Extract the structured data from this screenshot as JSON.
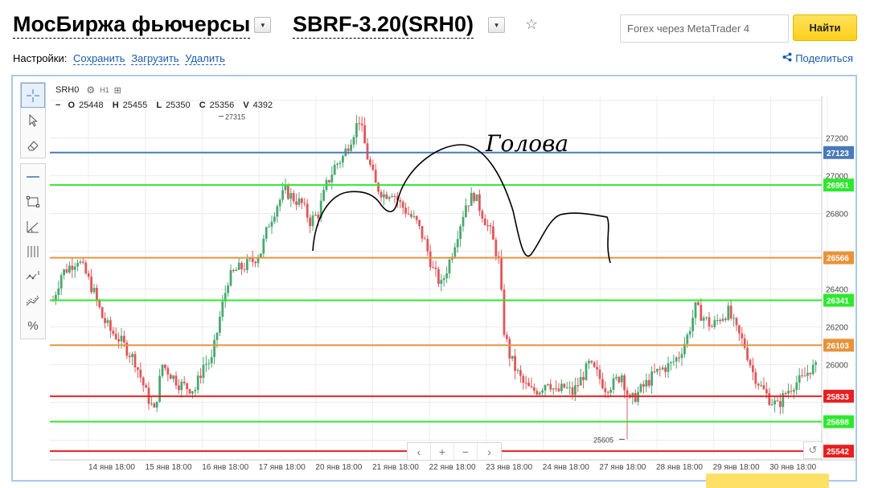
{
  "header": {
    "market_title": "МосБиржа фьючерсы",
    "symbol_title": "SBRF-3.20(SRH0)",
    "search_placeholder": "Forex через MetaTrader 4",
    "search_button": "Найти"
  },
  "settings": {
    "label": "Настройки:",
    "save": "Сохранить",
    "load": "Загрузить",
    "delete": "Удалить",
    "share": "Поделиться"
  },
  "legend": {
    "symbol": "SRH0",
    "timeframe": "H1",
    "o_label": "O",
    "o": "25448",
    "h_label": "H",
    "h": "25455",
    "l_label": "L",
    "l": "25350",
    "c_label": "C",
    "c": "25356",
    "v_label": "V",
    "v": "4392"
  },
  "colors": {
    "up": "#4aa870",
    "down": "#e0575b",
    "blue_level": "#4a7ab8",
    "green_level": "#2ee82e",
    "orange_level": "#e8933a",
    "red_level": "#e62020"
  },
  "icons": [
    "crosshair-icon",
    "cursor-icon",
    "eraser-icon",
    "horizontal-line-icon",
    "rectangle-icon",
    "trend-angle-icon",
    "vertical-lines-icon",
    "indicator-icon",
    "channel-icon",
    "percent-icon",
    "gear-icon",
    "compare-icon",
    "star-icon",
    "share-icon",
    "undo-icon"
  ],
  "chart_data": {
    "type": "candlestick",
    "symbol": "SRH0",
    "timeframe": "H1",
    "x_ticks": [
      "14 янв 18:00",
      "15 янв 18:00",
      "16 янв 18:00",
      "17 янв 18:00",
      "20 янв 18:00",
      "21 янв 18:00",
      "22 янв 18:00",
      "23 янв 18:00",
      "24 янв 18:00",
      "27 янв 18:00",
      "28 янв 18:00",
      "29 янв 18:00",
      "30 янв 18:00"
    ],
    "y_ticks": [
      26000,
      26200,
      26400,
      26800,
      27000,
      27200
    ],
    "ylim": [
      25530,
      27420
    ],
    "levels": [
      {
        "value": 27123,
        "label": "27123",
        "color": "#4a7ab8"
      },
      {
        "value": 26951,
        "label": "26951",
        "color": "#2ee82e"
      },
      {
        "value": 26566,
        "label": "26566",
        "color": "#e8933a"
      },
      {
        "value": 26341,
        "label": "26341",
        "color": "#2ee82e"
      },
      {
        "value": 26103,
        "label": "26103",
        "color": "#e8933a"
      },
      {
        "value": 25833,
        "label": "25833",
        "color": "#e62020"
      },
      {
        "value": 25698,
        "label": "25698",
        "color": "#2ee82e"
      },
      {
        "value": 25542,
        "label": "25542",
        "color": "#e62020"
      }
    ],
    "annotations": [
      {
        "text": "27315",
        "x_index": 60,
        "value": 27315
      },
      {
        "text": "25605",
        "x_index": 210,
        "value": 25605
      }
    ],
    "handwritten_text": "Голова",
    "anchors": [
      [
        0,
        26340
      ],
      [
        3,
        26480
      ],
      [
        6,
        26520
      ],
      [
        9,
        26560
      ],
      [
        12,
        26480
      ],
      [
        15,
        26380
      ],
      [
        18,
        26250
      ],
      [
        21,
        26180
      ],
      [
        24,
        26140
      ],
      [
        27,
        26080
      ],
      [
        30,
        26020
      ],
      [
        34,
        25850
      ],
      [
        37,
        25750
      ],
      [
        40,
        26000
      ],
      [
        43,
        25950
      ],
      [
        46,
        25900
      ],
      [
        49,
        25880
      ],
      [
        52,
        25870
      ],
      [
        55,
        26000
      ],
      [
        58,
        26020
      ],
      [
        61,
        26250
      ],
      [
        64,
        26450
      ],
      [
        67,
        26500
      ],
      [
        70,
        26520
      ],
      [
        73,
        26550
      ],
      [
        76,
        26600
      ],
      [
        79,
        26750
      ],
      [
        82,
        26850
      ],
      [
        85,
        26920
      ],
      [
        88,
        26880
      ],
      [
        91,
        26850
      ],
      [
        94,
        26760
      ],
      [
        97,
        26800
      ],
      [
        100,
        26950
      ],
      [
        103,
        27050
      ],
      [
        106,
        27100
      ],
      [
        109,
        27200
      ],
      [
        112,
        27300
      ],
      [
        115,
        27100
      ],
      [
        118,
        26950
      ],
      [
        121,
        26900
      ],
      [
        124,
        26920
      ],
      [
        127,
        26850
      ],
      [
        130,
        26800
      ],
      [
        133,
        26750
      ],
      [
        136,
        26650
      ],
      [
        139,
        26500
      ],
      [
        142,
        26420
      ],
      [
        145,
        26550
      ],
      [
        148,
        26700
      ],
      [
        151,
        26850
      ],
      [
        154,
        26900
      ],
      [
        157,
        26800
      ],
      [
        160,
        26700
      ],
      [
        163,
        26550
      ],
      [
        165,
        26180
      ],
      [
        167,
        26050
      ],
      [
        169,
        25980
      ],
      [
        172,
        25900
      ],
      [
        175,
        25860
      ],
      [
        178,
        25870
      ],
      [
        181,
        25920
      ],
      [
        184,
        25850
      ],
      [
        187,
        25880
      ],
      [
        190,
        25850
      ],
      [
        193,
        25920
      ],
      [
        196,
        26000
      ],
      [
        199,
        25950
      ],
      [
        202,
        25880
      ],
      [
        205,
        25900
      ],
      [
        208,
        25950
      ],
      [
        211,
        25800
      ],
      [
        214,
        25850
      ],
      [
        217,
        25900
      ],
      [
        220,
        25950
      ],
      [
        223,
        25980
      ],
      [
        226,
        26000
      ],
      [
        229,
        26050
      ],
      [
        232,
        26150
      ],
      [
        235,
        26300
      ],
      [
        238,
        26250
      ],
      [
        241,
        26200
      ],
      [
        244,
        26250
      ],
      [
        247,
        26280
      ],
      [
        250,
        26180
      ],
      [
        253,
        26100
      ],
      [
        256,
        25960
      ],
      [
        259,
        25880
      ],
      [
        262,
        25820
      ],
      [
        265,
        25780
      ],
      [
        268,
        25850
      ],
      [
        271,
        25900
      ],
      [
        274,
        25920
      ],
      [
        277,
        25980
      ]
    ]
  }
}
